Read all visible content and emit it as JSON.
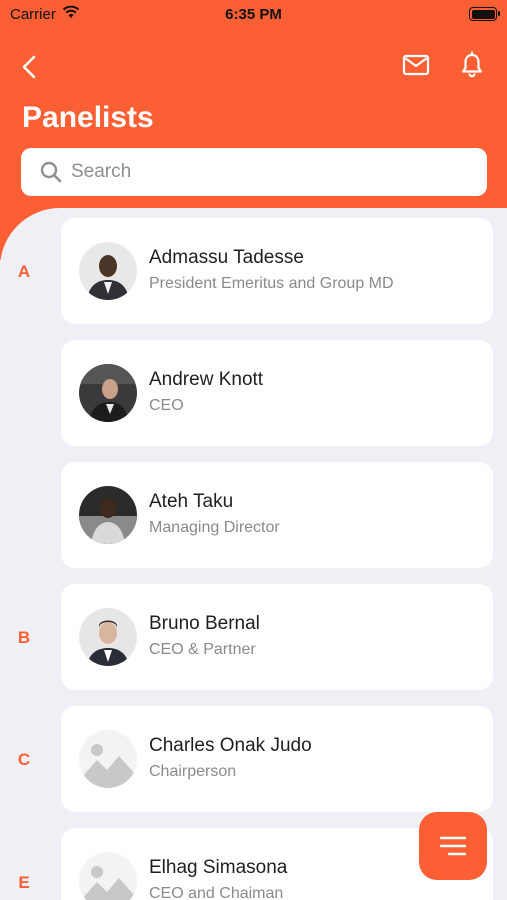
{
  "status_bar": {
    "carrier": "Carrier",
    "time": "6:35 PM"
  },
  "header": {
    "title": "Panelists"
  },
  "search": {
    "placeholder": "Search"
  },
  "sections": [
    {
      "letter": "A"
    },
    {
      "letter": "B"
    },
    {
      "letter": "C"
    },
    {
      "letter": "E"
    }
  ],
  "panelists": [
    {
      "name": "Admassu  Tadesse",
      "role": "President Emeritus and Group MD",
      "avatar": "photo"
    },
    {
      "name": "Andrew  Knott",
      "role": "CEO",
      "avatar": "photo"
    },
    {
      "name": "Ateh  Taku",
      "role": "Managing Director",
      "avatar": "photo"
    },
    {
      "name": "Bruno Bernal",
      "role": "CEO & Partner",
      "avatar": "photo"
    },
    {
      "name": "Charles  Onak Judo",
      "role": "Chairperson",
      "avatar": "placeholder-image-icon"
    },
    {
      "name": "Elhag  Simasona",
      "role": "CEO and Chaiman",
      "avatar": "placeholder-image-icon"
    }
  ],
  "colors": {
    "accent": "#fc5f34",
    "background": "#eef0f6",
    "card": "#ffffff"
  }
}
